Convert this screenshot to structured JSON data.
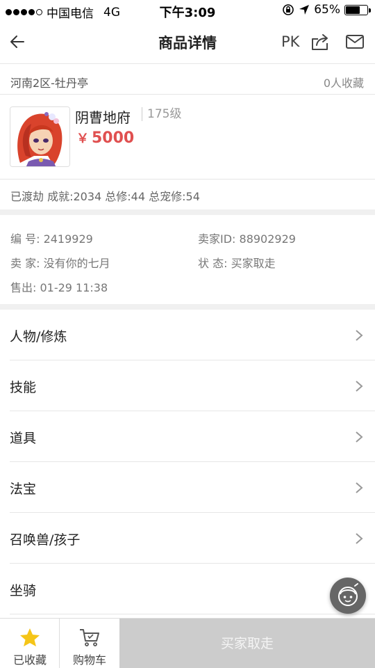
{
  "status_bar": {
    "carrier": "中国电信",
    "network": "4G",
    "time": "下午3:09",
    "battery": "65%",
    "battery_level": 0.65
  },
  "nav": {
    "title": "商品详情",
    "pk_label": "PK"
  },
  "listing": {
    "server": "河南2区-牡丹亭",
    "favorites": "0人收藏",
    "character_name": "阴曹地府",
    "level": "175级",
    "currency_symbol": "￥",
    "price": "5000",
    "stats": "已渡劫 成就:2034 总修:44 总宠修:54"
  },
  "info": {
    "id": "编  号: 2419929",
    "seller_id": "卖家ID: 88902929",
    "seller": "卖  家: 没有你的七月",
    "status": "状  态: 买家取走",
    "sold": "售出: 01-29 11:38"
  },
  "menu": [
    {
      "label": "人物/修炼"
    },
    {
      "label": "技能"
    },
    {
      "label": "道具"
    },
    {
      "label": "法宝"
    },
    {
      "label": "召唤兽/孩子"
    },
    {
      "label": "坐骑"
    }
  ],
  "bottom": {
    "fav_label": "已收藏",
    "cart_label": "购物车",
    "buy_label": "买家取走"
  },
  "colors": {
    "price": "#e05050",
    "star": "#f5c518",
    "buy_disabled": "#cccccc",
    "separator": "#f0f0f0"
  },
  "icons": [
    "back-arrow-icon",
    "share-icon",
    "mail-icon",
    "chevron-right-icon",
    "star-icon",
    "cart-icon",
    "customer-service-icon",
    "location-arrow-icon",
    "orientation-lock-icon"
  ]
}
